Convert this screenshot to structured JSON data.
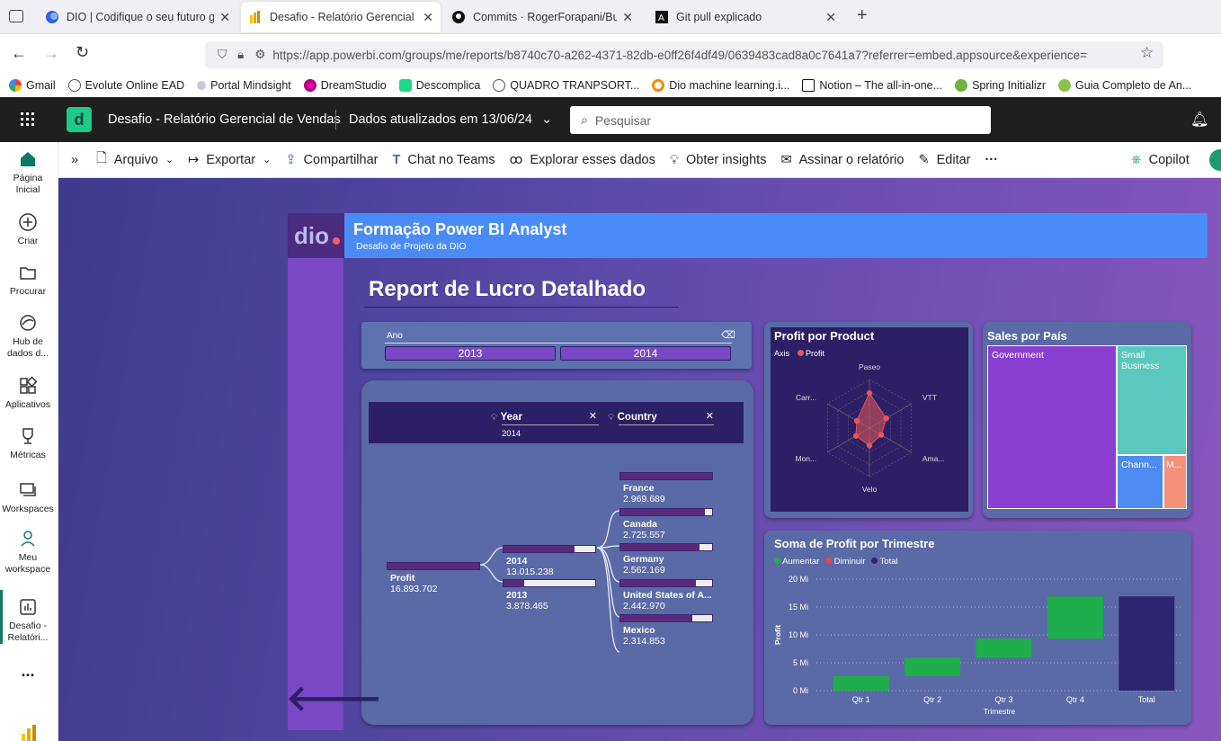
{
  "browser": {
    "tabs": [
      {
        "title": "DIO | Codifique o seu futuro glo",
        "active": false
      },
      {
        "title": "Desafio - Relatório Gerencial de",
        "active": true
      },
      {
        "title": "Commits · RogerForapani/Busi",
        "active": false
      },
      {
        "title": "Git pull explicado",
        "active": false
      }
    ],
    "url": "https://app.powerbi.com/groups/me/reports/b8740c70-a262-4371-82db-e0ff26f4df49/0639483cad8a0c7641a7?referrer=embed.appsource&experience=",
    "bookmarks": [
      "Gmail",
      "Evolute Online EAD",
      "Portal Mindsight",
      "DreamStudio",
      "Descomplica",
      "QUADRO TRANPSORT...",
      "Dio machine learning.i...",
      "Notion – The all-in-one...",
      "Spring Initializr",
      "Guia Completo de An..."
    ]
  },
  "pbi": {
    "report_name": "Desafio - Relatório Gerencial de Vendas",
    "data_updated": "Dados atualizados em 13/06/24",
    "search_placeholder": "Pesquisar",
    "toolbar": {
      "arquivo": "Arquivo",
      "exportar": "Exportar",
      "compartilhar": "Compartilhar",
      "chat": "Chat no Teams",
      "explorar": "Explorar esses dados",
      "insights": "Obter insights",
      "assinar": "Assinar o relatório",
      "editar": "Editar",
      "more": "···",
      "copilot": "Copilot"
    },
    "leftnav": {
      "home": "Página Inicial",
      "create": "Criar",
      "browse": "Procurar",
      "datahub": "Hub de dados d...",
      "apps": "Aplicativos",
      "metrics": "Métricas",
      "workspaces": "Workspaces",
      "my_workspace": "Meu workspace",
      "current": "Desafio - Relatóri...",
      "more": "..."
    }
  },
  "report": {
    "banner_title": "Formação Power BI Analyst",
    "banner_subtitle": "Desafio de Projeto da DIO",
    "page_title": "Report de Lucro Detalhado",
    "slicer": {
      "label": "Ano",
      "options": [
        "2013",
        "2014"
      ]
    },
    "decomp": {
      "filter_year_label": "Year",
      "filter_year_value": "2014",
      "filter_country_label": "Country",
      "root": {
        "label": "Profit",
        "value": "16.893.702"
      },
      "years": [
        {
          "label": "2014",
          "value": "13.015.238",
          "fill": 0.77
        },
        {
          "label": "2013",
          "value": "3.878.465",
          "fill": 0.23
        }
      ],
      "countries": [
        {
          "label": "France",
          "value": "2.969.689",
          "fill": 1.0
        },
        {
          "label": "Canada",
          "value": "2.725.557",
          "fill": 0.92
        },
        {
          "label": "Germany",
          "value": "2.562.169",
          "fill": 0.86
        },
        {
          "label": "United States of A...",
          "value": "2.442.970",
          "fill": 0.82
        },
        {
          "label": "Mexico",
          "value": "2.314.853",
          "fill": 0.78
        }
      ]
    },
    "radar": {
      "title": "Profit por Product",
      "legend_axis": "Axis",
      "legend_profit": "Profit",
      "axes": [
        "Paseo",
        "VTT",
        "Ama...",
        "Velo",
        "Mon...",
        "Carr..."
      ],
      "values": [
        0.72,
        0.4,
        0.28,
        0.36,
        0.32,
        0.3
      ],
      "color": "#e8555a"
    },
    "treemap": {
      "title": "Sales por País",
      "tiles": [
        "Government",
        "Small Business",
        "Chann...",
        "M..."
      ],
      "colors": [
        "#8a3fd0",
        "#5ac8be",
        "#4d8cf0",
        "#f5907a"
      ]
    },
    "waterfall": {
      "title": "Soma de Profit por Trimestre",
      "legend": [
        "Aumentar",
        "Diminuir",
        "Total"
      ],
      "legend_colors": [
        "#1fae4b",
        "#e8444a",
        "#2d2570"
      ],
      "ylabel": "Profit",
      "xlabel": "Trimestre",
      "yticks": [
        "20 Mi",
        "15 Mi",
        "10 Mi",
        "5 Mi",
        "0 Mi"
      ]
    }
  },
  "chart_data": {
    "type": "waterfall",
    "title": "Soma de Profit por Trimestre",
    "categories": [
      "Qtr 1",
      "Qtr 2",
      "Qtr 3",
      "Qtr 4",
      "Total"
    ],
    "steps": [
      2.6,
      3.3,
      3.4,
      7.6
    ],
    "total": 16.9,
    "ylim": [
      0,
      20
    ],
    "xlabel": "Trimestre",
    "ylabel": "Profit"
  }
}
